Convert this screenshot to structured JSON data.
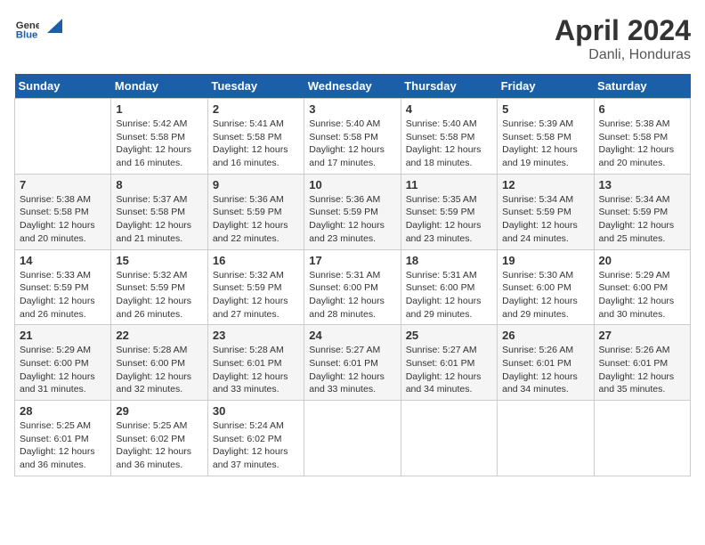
{
  "header": {
    "logo_general": "General",
    "logo_blue": "Blue",
    "title": "April 2024",
    "subtitle": "Danli, Honduras"
  },
  "calendar": {
    "weekdays": [
      "Sunday",
      "Monday",
      "Tuesday",
      "Wednesday",
      "Thursday",
      "Friday",
      "Saturday"
    ],
    "weeks": [
      [
        {
          "num": "",
          "info": ""
        },
        {
          "num": "1",
          "info": "Sunrise: 5:42 AM\nSunset: 5:58 PM\nDaylight: 12 hours\nand 16 minutes."
        },
        {
          "num": "2",
          "info": "Sunrise: 5:41 AM\nSunset: 5:58 PM\nDaylight: 12 hours\nand 16 minutes."
        },
        {
          "num": "3",
          "info": "Sunrise: 5:40 AM\nSunset: 5:58 PM\nDaylight: 12 hours\nand 17 minutes."
        },
        {
          "num": "4",
          "info": "Sunrise: 5:40 AM\nSunset: 5:58 PM\nDaylight: 12 hours\nand 18 minutes."
        },
        {
          "num": "5",
          "info": "Sunrise: 5:39 AM\nSunset: 5:58 PM\nDaylight: 12 hours\nand 19 minutes."
        },
        {
          "num": "6",
          "info": "Sunrise: 5:38 AM\nSunset: 5:58 PM\nDaylight: 12 hours\nand 20 minutes."
        }
      ],
      [
        {
          "num": "7",
          "info": "Sunrise: 5:38 AM\nSunset: 5:58 PM\nDaylight: 12 hours\nand 20 minutes."
        },
        {
          "num": "8",
          "info": "Sunrise: 5:37 AM\nSunset: 5:58 PM\nDaylight: 12 hours\nand 21 minutes."
        },
        {
          "num": "9",
          "info": "Sunrise: 5:36 AM\nSunset: 5:59 PM\nDaylight: 12 hours\nand 22 minutes."
        },
        {
          "num": "10",
          "info": "Sunrise: 5:36 AM\nSunset: 5:59 PM\nDaylight: 12 hours\nand 23 minutes."
        },
        {
          "num": "11",
          "info": "Sunrise: 5:35 AM\nSunset: 5:59 PM\nDaylight: 12 hours\nand 23 minutes."
        },
        {
          "num": "12",
          "info": "Sunrise: 5:34 AM\nSunset: 5:59 PM\nDaylight: 12 hours\nand 24 minutes."
        },
        {
          "num": "13",
          "info": "Sunrise: 5:34 AM\nSunset: 5:59 PM\nDaylight: 12 hours\nand 25 minutes."
        }
      ],
      [
        {
          "num": "14",
          "info": "Sunrise: 5:33 AM\nSunset: 5:59 PM\nDaylight: 12 hours\nand 26 minutes."
        },
        {
          "num": "15",
          "info": "Sunrise: 5:32 AM\nSunset: 5:59 PM\nDaylight: 12 hours\nand 26 minutes."
        },
        {
          "num": "16",
          "info": "Sunrise: 5:32 AM\nSunset: 5:59 PM\nDaylight: 12 hours\nand 27 minutes."
        },
        {
          "num": "17",
          "info": "Sunrise: 5:31 AM\nSunset: 6:00 PM\nDaylight: 12 hours\nand 28 minutes."
        },
        {
          "num": "18",
          "info": "Sunrise: 5:31 AM\nSunset: 6:00 PM\nDaylight: 12 hours\nand 29 minutes."
        },
        {
          "num": "19",
          "info": "Sunrise: 5:30 AM\nSunset: 6:00 PM\nDaylight: 12 hours\nand 29 minutes."
        },
        {
          "num": "20",
          "info": "Sunrise: 5:29 AM\nSunset: 6:00 PM\nDaylight: 12 hours\nand 30 minutes."
        }
      ],
      [
        {
          "num": "21",
          "info": "Sunrise: 5:29 AM\nSunset: 6:00 PM\nDaylight: 12 hours\nand 31 minutes."
        },
        {
          "num": "22",
          "info": "Sunrise: 5:28 AM\nSunset: 6:00 PM\nDaylight: 12 hours\nand 32 minutes."
        },
        {
          "num": "23",
          "info": "Sunrise: 5:28 AM\nSunset: 6:01 PM\nDaylight: 12 hours\nand 33 minutes."
        },
        {
          "num": "24",
          "info": "Sunrise: 5:27 AM\nSunset: 6:01 PM\nDaylight: 12 hours\nand 33 minutes."
        },
        {
          "num": "25",
          "info": "Sunrise: 5:27 AM\nSunset: 6:01 PM\nDaylight: 12 hours\nand 34 minutes."
        },
        {
          "num": "26",
          "info": "Sunrise: 5:26 AM\nSunset: 6:01 PM\nDaylight: 12 hours\nand 34 minutes."
        },
        {
          "num": "27",
          "info": "Sunrise: 5:26 AM\nSunset: 6:01 PM\nDaylight: 12 hours\nand 35 minutes."
        }
      ],
      [
        {
          "num": "28",
          "info": "Sunrise: 5:25 AM\nSunset: 6:01 PM\nDaylight: 12 hours\nand 36 minutes."
        },
        {
          "num": "29",
          "info": "Sunrise: 5:25 AM\nSunset: 6:02 PM\nDaylight: 12 hours\nand 36 minutes."
        },
        {
          "num": "30",
          "info": "Sunrise: 5:24 AM\nSunset: 6:02 PM\nDaylight: 12 hours\nand 37 minutes."
        },
        {
          "num": "",
          "info": ""
        },
        {
          "num": "",
          "info": ""
        },
        {
          "num": "",
          "info": ""
        },
        {
          "num": "",
          "info": ""
        }
      ]
    ]
  }
}
